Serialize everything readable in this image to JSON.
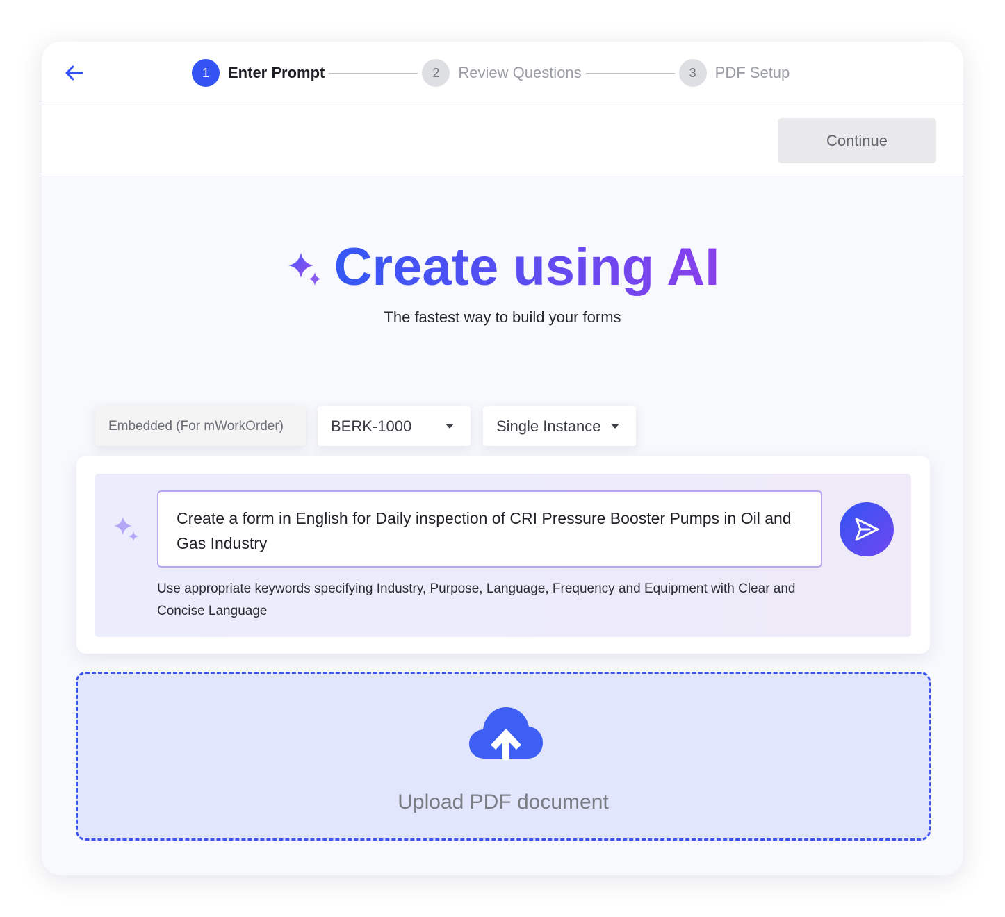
{
  "header": {
    "back_icon": "arrow-left-icon",
    "steps": [
      {
        "number": "1",
        "label": "Enter Prompt",
        "state": "active"
      },
      {
        "number": "2",
        "label": "Review Questions",
        "state": "inactive"
      },
      {
        "number": "3",
        "label": "PDF Setup",
        "state": "inactive"
      }
    ]
  },
  "actionbar": {
    "continue_label": "Continue"
  },
  "hero": {
    "title": "Create using AI",
    "subtitle": "The fastest way to build your forms",
    "icon": "sparkle-icon"
  },
  "filters": {
    "embedded_label": "Embedded (For mWorkOrder)",
    "asset_value": "BERK-1000",
    "instance_value": "Single Instance"
  },
  "prompt": {
    "text": "Create a form in English for Daily inspection of CRI Pressure Booster Pumps in Oil and Gas Industry",
    "hint": "Use appropriate keywords specifying Industry, Purpose, Language, Frequency and Equipment with Clear and Concise Language",
    "send_icon": "send-icon"
  },
  "upload": {
    "label": "Upload PDF document",
    "icon": "cloud-upload-icon"
  },
  "colors": {
    "primary": "#3353f4",
    "accent_purple": "#8a40ec",
    "upload_border": "#3d54ec",
    "upload_bg": "#e2e6fc"
  }
}
